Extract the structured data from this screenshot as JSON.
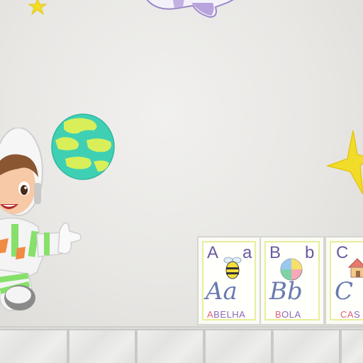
{
  "alphabet_cards": [
    {
      "upper": "A",
      "lower": "a",
      "cursive": "Aa",
      "word_first": "A",
      "word_rest": "BELHA",
      "picture": "bee-icon"
    },
    {
      "upper": "B",
      "lower": "b",
      "cursive": "Bb",
      "word_first": "B",
      "word_rest": "OLA",
      "picture": "ball-icon"
    },
    {
      "upper": "C",
      "lower": "",
      "cursive": "C",
      "word_first": "CA",
      "word_rest": "S",
      "picture": "house-icon"
    }
  ],
  "colors": {
    "wall": "#e9e8e6",
    "star": "#f2dc2a",
    "planet_main": "#3fd0b4",
    "planet_spots": "#d8ef5a",
    "suit_green": "#86e06a",
    "card_border": "#e9ee9a"
  }
}
